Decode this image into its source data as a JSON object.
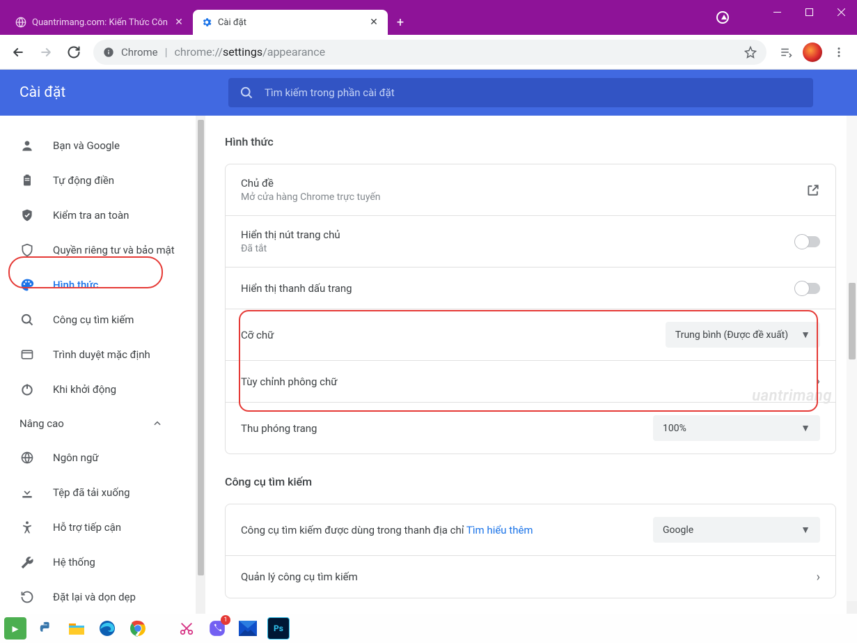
{
  "titlebar": {
    "tab_inactive": "Quantrimang.com: Kiến Thức Côn",
    "tab_active": "Cài đặt"
  },
  "omnibox": {
    "label_chrome": "Chrome",
    "url_prefix": "chrome://",
    "url_bold": "settings",
    "url_suffix": "/appearance"
  },
  "header": {
    "title": "Cài đặt",
    "search_placeholder": "Tìm kiếm trong phần cài đặt"
  },
  "sidebar": {
    "items": [
      {
        "label": "Bạn và Google"
      },
      {
        "label": "Tự động điền"
      },
      {
        "label": "Kiểm tra an toàn"
      },
      {
        "label": "Quyền riêng tư và bảo mật"
      },
      {
        "label": "Hình thức"
      },
      {
        "label": "Công cụ tìm kiếm"
      },
      {
        "label": "Trình duyệt mặc định"
      },
      {
        "label": "Khi khởi động"
      }
    ],
    "advanced": "Nâng cao",
    "adv_items": [
      {
        "label": "Ngôn ngữ"
      },
      {
        "label": "Tệp đã tải xuống"
      },
      {
        "label": "Hỗ trợ tiếp cận"
      },
      {
        "label": "Hệ thống"
      },
      {
        "label": "Đặt lại và dọn dẹp"
      }
    ]
  },
  "sections": {
    "appearance": {
      "title": "Hình thức",
      "theme_title": "Chủ đề",
      "theme_sub": "Mở cửa hàng Chrome trực tuyến",
      "home_btn_title": "Hiển thị nút trang chủ",
      "home_btn_sub": "Đã tắt",
      "bookmark_bar": "Hiển thị thanh dấu trang",
      "font_size": "Cỡ chữ",
      "font_size_value": "Trung bình (Được đề xuất)",
      "custom_fonts": "Tùy chỉnh phông chữ",
      "page_zoom": "Thu phóng trang",
      "page_zoom_value": "100%"
    },
    "search": {
      "title": "Công cụ tìm kiếm",
      "engine_row": "Công cụ tìm kiếm được dùng trong thanh địa chỉ",
      "learn_more": "Tìm hiểu thêm",
      "engine_value": "Google",
      "manage": "Quản lý công cụ tìm kiếm"
    },
    "default_browser_trunc": "Trình duyệt mặc định"
  },
  "taskbar": {
    "viber_badge": "1"
  },
  "watermark": "uantrimang"
}
